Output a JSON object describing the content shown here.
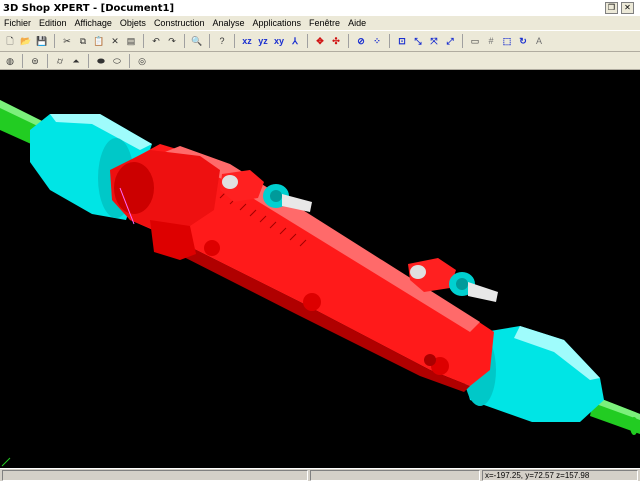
{
  "window": {
    "title": "3D Shop XPERT - [Document1]",
    "close_glyph": "✕",
    "restore_glyph": "❐"
  },
  "menu": [
    {
      "label": "Fichier"
    },
    {
      "label": "Edition"
    },
    {
      "label": "Affichage"
    },
    {
      "label": "Objets"
    },
    {
      "label": "Construction"
    },
    {
      "label": "Analyse"
    },
    {
      "label": "Applications"
    },
    {
      "label": "Fenêtre"
    },
    {
      "label": "Aide"
    }
  ],
  "toolbar1": [
    {
      "name": "new-icon",
      "glyph": "🗋"
    },
    {
      "name": "open-icon",
      "glyph": "📂"
    },
    {
      "name": "save-icon",
      "glyph": "💾"
    },
    {
      "name": "sep"
    },
    {
      "name": "cut-icon",
      "glyph": "✂"
    },
    {
      "name": "copy-icon",
      "glyph": "⧉"
    },
    {
      "name": "paste-icon",
      "glyph": "📋"
    },
    {
      "name": "delete-icon",
      "glyph": "✕"
    },
    {
      "name": "properties-icon",
      "glyph": "▤"
    },
    {
      "name": "sep"
    },
    {
      "name": "undo-icon",
      "glyph": "↶"
    },
    {
      "name": "redo-icon",
      "glyph": "↷"
    },
    {
      "name": "sep"
    },
    {
      "name": "zoom-select-icon",
      "glyph": "🔍"
    },
    {
      "name": "sep"
    },
    {
      "name": "help-icon",
      "glyph": "?"
    },
    {
      "name": "sep"
    },
    {
      "name": "view-xz-icon",
      "glyph": "xz",
      "cls": "blue"
    },
    {
      "name": "view-yz-icon",
      "glyph": "yz",
      "cls": "blue"
    },
    {
      "name": "view-xy-icon",
      "glyph": "xy",
      "cls": "blue"
    },
    {
      "name": "view-iso-icon",
      "glyph": "⅄",
      "cls": "blue"
    },
    {
      "name": "sep"
    },
    {
      "name": "move-icon",
      "glyph": "✥",
      "cls": "red"
    },
    {
      "name": "pan-icon",
      "glyph": "✣",
      "cls": "red"
    },
    {
      "name": "sep"
    },
    {
      "name": "rotate-icon",
      "glyph": "⊘",
      "cls": "blue"
    },
    {
      "name": "center-icon",
      "glyph": "⁘",
      "cls": "blue"
    },
    {
      "name": "sep"
    },
    {
      "name": "zoom-window-icon",
      "glyph": "⊡",
      "cls": "blue"
    },
    {
      "name": "zoom-in-icon",
      "glyph": "⤡",
      "cls": "blue"
    },
    {
      "name": "zoom-extents-icon",
      "glyph": "⤧",
      "cls": "blue"
    },
    {
      "name": "zoom-all-icon",
      "glyph": "⤢",
      "cls": "blue"
    },
    {
      "name": "sep"
    },
    {
      "name": "folder-icon",
      "glyph": "▭"
    },
    {
      "name": "grid-icon",
      "glyph": "#",
      "cls": "grey"
    },
    {
      "name": "select-box-icon",
      "glyph": "⬚",
      "cls": "blue"
    },
    {
      "name": "refresh-icon",
      "glyph": "↻",
      "cls": "blue"
    },
    {
      "name": "text-icon",
      "glyph": "A",
      "cls": "grey"
    }
  ],
  "toolbar2": [
    {
      "name": "sphere-icon",
      "glyph": "◍"
    },
    {
      "name": "sep"
    },
    {
      "name": "disk-icon",
      "glyph": "⊜"
    },
    {
      "name": "sep"
    },
    {
      "name": "cylinder-icon",
      "glyph": "⌭"
    },
    {
      "name": "cone-icon",
      "glyph": "⏶"
    },
    {
      "name": "sep"
    },
    {
      "name": "extrude-icon",
      "glyph": "⬬"
    },
    {
      "name": "tube-icon",
      "glyph": "⬭"
    },
    {
      "name": "sep"
    },
    {
      "name": "torus-icon",
      "glyph": "◎"
    }
  ],
  "status": {
    "message": "",
    "middle": "",
    "coords": "x=-197.25, y=72.57 z=157.98"
  },
  "colors": {
    "background": "#000000",
    "body": "#ff0000",
    "boot": "#00e5e5",
    "shaft": "#22cc22",
    "fitting": "#d0d0d0"
  }
}
